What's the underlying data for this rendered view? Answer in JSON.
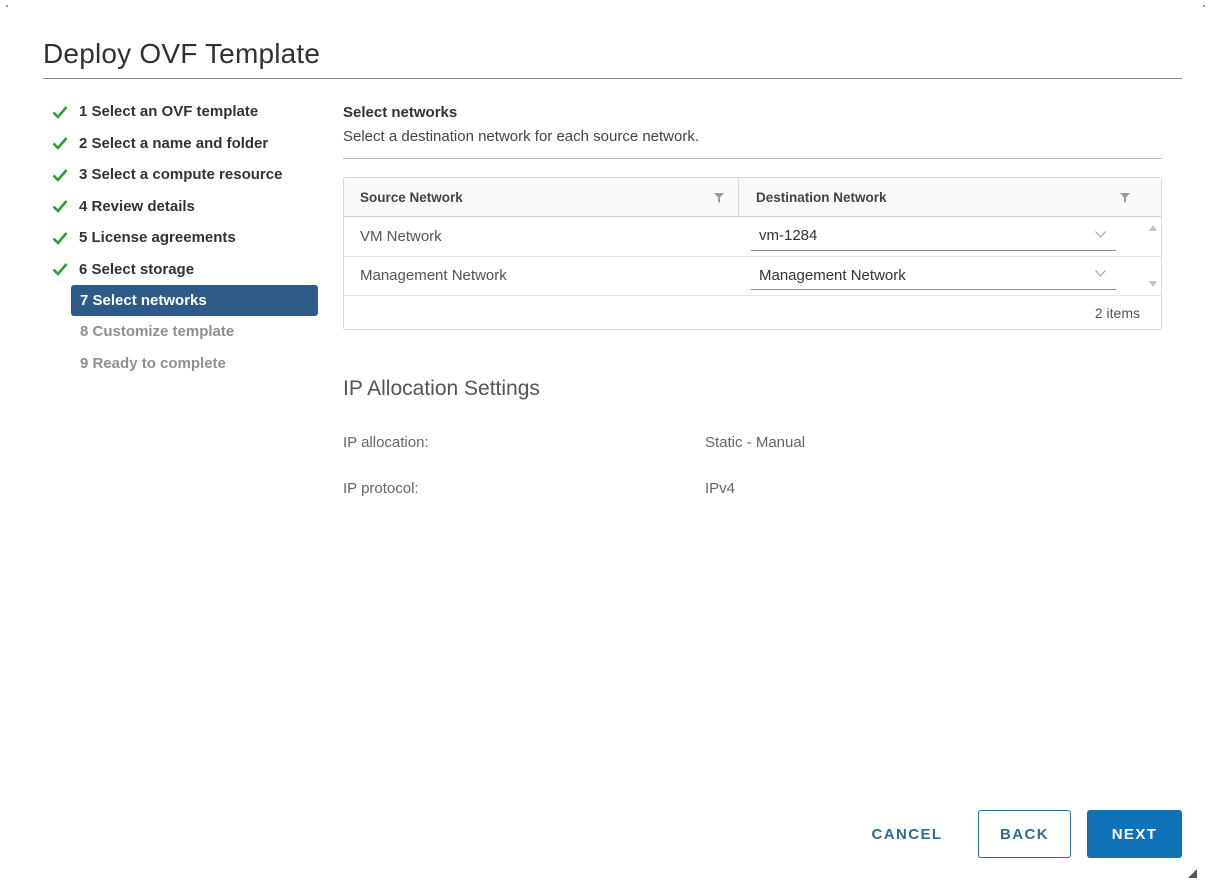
{
  "dialog": {
    "title": "Deploy OVF Template"
  },
  "steps": [
    {
      "label": "1 Select an OVF template",
      "state": "done"
    },
    {
      "label": "2 Select a name and folder",
      "state": "done"
    },
    {
      "label": "3 Select a compute resource",
      "state": "done"
    },
    {
      "label": "4 Review details",
      "state": "done"
    },
    {
      "label": "5 License agreements",
      "state": "done"
    },
    {
      "label": "6 Select storage",
      "state": "done"
    },
    {
      "label": "7 Select networks",
      "state": "active"
    },
    {
      "label": "8 Customize template",
      "state": "pending"
    },
    {
      "label": "9 Ready to complete",
      "state": "pending"
    }
  ],
  "main": {
    "section_title": "Select networks",
    "section_desc": "Select a destination network for each source network.",
    "grid": {
      "columns": [
        "Source Network",
        "Destination Network"
      ],
      "rows": [
        {
          "source": "VM Network",
          "destination": "vm-1284"
        },
        {
          "source": "Management Network",
          "destination": "Management Network"
        }
      ],
      "footer": "2 items"
    },
    "ip_settings": {
      "title": "IP Allocation Settings",
      "rows": [
        {
          "label": "IP allocation:",
          "value": "Static - Manual"
        },
        {
          "label": "IP protocol:",
          "value": "IPv4"
        }
      ]
    }
  },
  "buttons": {
    "cancel": "CANCEL",
    "back": "BACK",
    "next": "NEXT"
  },
  "colors": {
    "check": "#2e9e3b",
    "active_step_bg": "#2d5a86",
    "primary": "#0f72b7",
    "link": "#2d6d99"
  },
  "icons": {
    "step_done": "check-icon",
    "filter": "filter-icon",
    "select": "chevron-down-icon",
    "resize": "resize-grip-icon"
  }
}
